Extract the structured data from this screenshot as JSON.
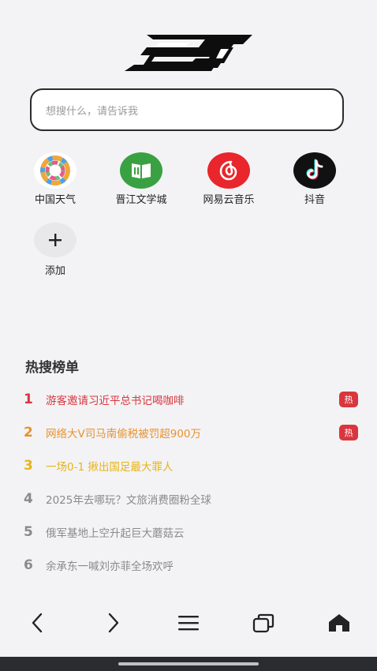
{
  "search": {
    "placeholder": "想搜什么，请告诉我"
  },
  "shortcuts": [
    {
      "label": "中国天气",
      "icon": "weather-pinwheel-icon"
    },
    {
      "label": "晋江文学城",
      "icon": "book-icon"
    },
    {
      "label": "网易云音乐",
      "icon": "netease-music-icon"
    },
    {
      "label": "抖音",
      "icon": "tiktok-icon"
    },
    {
      "label": "添加",
      "icon": "plus-icon"
    }
  ],
  "hot": {
    "title": "热搜榜单",
    "badge_label": "热",
    "items": [
      {
        "rank": "1",
        "text": "游客邀请习近平总书记喝咖啡",
        "color": "#d9363e",
        "hot": true
      },
      {
        "rank": "2",
        "text": "网络大V司马南偷税被罚超900万",
        "color": "#e8912c",
        "hot": true
      },
      {
        "rank": "3",
        "text": "一场0-1 揪出国足最大罪人",
        "color": "#e7b416",
        "hot": false
      },
      {
        "rank": "4",
        "text": "2025年去哪玩？文旅消费圈粉全球",
        "color": "#8a8a8a",
        "hot": false
      },
      {
        "rank": "5",
        "text": "俄军基地上空升起巨大蘑菇云",
        "color": "#8a8a8a",
        "hot": false
      },
      {
        "rank": "6",
        "text": "余承东一喊刘亦菲全场欢呼",
        "color": "#8a8a8a",
        "hot": false
      }
    ]
  },
  "colors": {
    "accent_red": "#d9363e",
    "accent_orange": "#e8912c",
    "accent_yellow": "#e7b416",
    "gray": "#8a8a8a"
  }
}
